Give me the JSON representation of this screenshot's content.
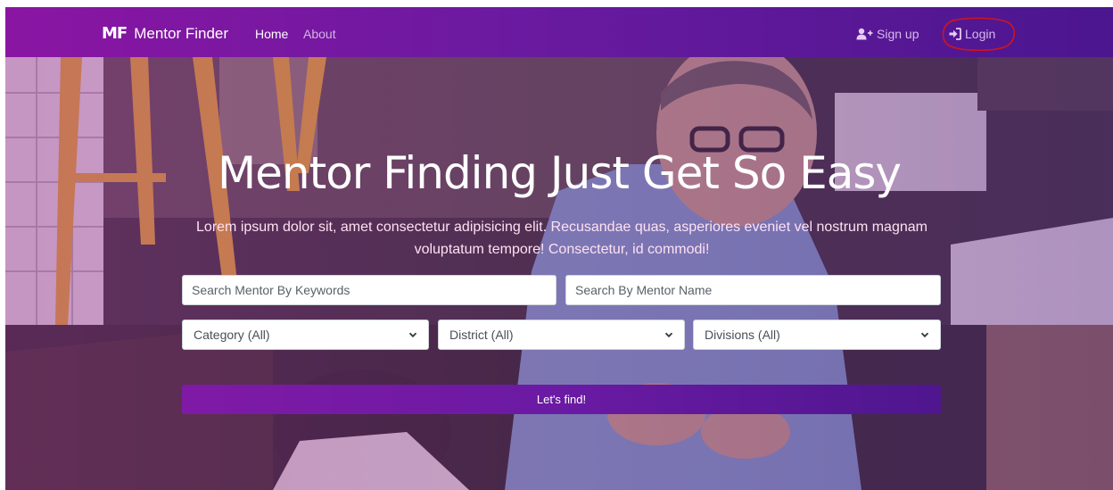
{
  "navbar": {
    "brand_logo": "MF",
    "brand_name": "Mentor Finder",
    "links": [
      {
        "label": "Home"
      },
      {
        "label": "About"
      }
    ],
    "signup_label": "Sign up",
    "login_label": "Login"
  },
  "hero": {
    "headline": "Mentor Finding Just Get So Easy",
    "subtext": "Lorem ipsum dolor sit, amet consectetur adipisicing elit. Recusandae quas, asperiores eveniet vel nostrum magnam voluptatum tempore! Consectetur, id commodi!"
  },
  "search": {
    "keywords_placeholder": "Search Mentor By Keywords",
    "name_placeholder": "Search By Mentor Name",
    "category_selected": "Category (All)",
    "district_selected": "District (All)",
    "divisions_selected": "Divisions (All)",
    "submit_label": "Let's find!"
  },
  "colors": {
    "nav_gradient_start": "#8a15a3",
    "nav_gradient_end": "#4b168f",
    "button_gradient_start": "#7f1aa6",
    "button_gradient_end": "#4f168f",
    "annotation_red": "#d0141c"
  },
  "icons": {
    "signup": "user-plus-icon",
    "login": "sign-in-icon",
    "select": "chevron-down-icon"
  }
}
